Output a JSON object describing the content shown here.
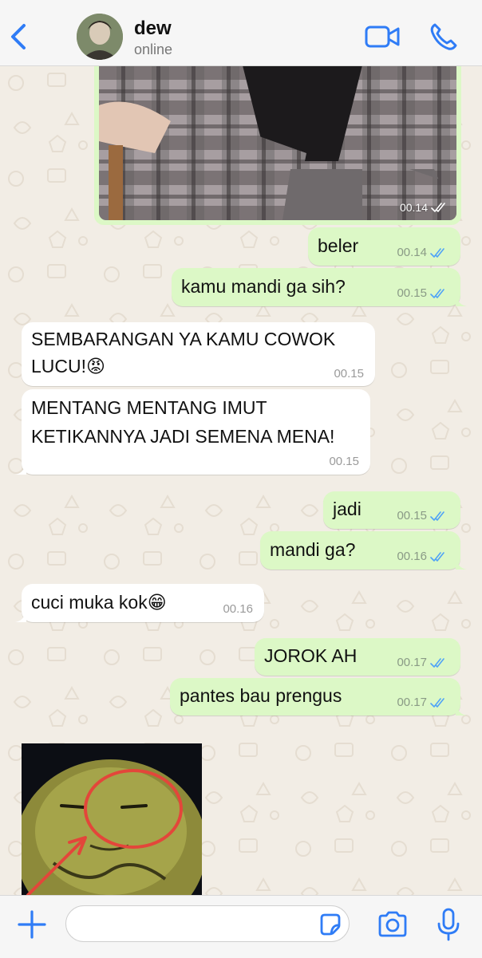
{
  "header": {
    "contact_name": "dew",
    "status": "online",
    "icons": [
      "chevron-left-icon",
      "video-camera-icon",
      "phone-icon"
    ]
  },
  "photo_message": {
    "time": "00.14",
    "status": "read"
  },
  "messages": [
    {
      "direction": "out",
      "text": "beler",
      "time": "00.14",
      "status": "read"
    },
    {
      "direction": "out",
      "text": "kamu mandi ga sih?",
      "time": "00.15",
      "status": "read"
    },
    {
      "direction": "in",
      "lines": [
        "SEMBARANGAN YA KAMU COWOK",
        "LUCU!😡"
      ],
      "time": "00.15"
    },
    {
      "direction": "in",
      "lines": [
        "MENTANG MENTANG IMUT",
        "KETIKANNYA JADI SEMENA MENA!"
      ],
      "time": "00.15"
    },
    {
      "direction": "out",
      "text": "jadi",
      "time": "00.15",
      "status": "read"
    },
    {
      "direction": "out",
      "text": "mandi ga?",
      "time": "00.16",
      "status": "read"
    },
    {
      "direction": "in",
      "text": "cuci muka kok😁",
      "time": "00.16"
    },
    {
      "direction": "out",
      "text": "JOROK AH",
      "time": "00.17",
      "status": "read"
    },
    {
      "direction": "out",
      "text": "pantes bau prengus",
      "time": "00.17",
      "status": "read"
    }
  ],
  "input": {
    "value": "",
    "placeholder": ""
  },
  "colors": {
    "accent": "#2f7cf6",
    "outgoing_bubble": "#dcf8c6",
    "incoming_bubble": "#ffffff",
    "read_tick": "#4fa3f7",
    "wallpaper": "#f2ede5"
  }
}
